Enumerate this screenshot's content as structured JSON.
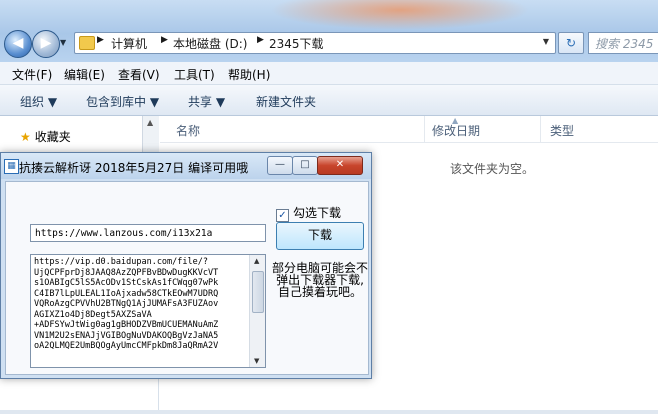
{
  "explorer": {
    "path": [
      "计算机",
      "本地磁盘 (D:)",
      "2345下载"
    ],
    "search_placeholder": "搜索 2345",
    "menu": [
      "文件(F)",
      "编辑(E)",
      "查看(V)",
      "工具(T)",
      "帮助(H)"
    ],
    "toolbar": [
      "组织 ▼",
      "包含到库中 ▼",
      "共享 ▼",
      "新建文件夹"
    ],
    "favorites": "收藏夹",
    "columns": [
      "名称",
      "修改日期",
      "类型"
    ],
    "empty_text": "该文件夹为空。"
  },
  "dialog": {
    "title": "抗揍云解析讶 2018年5月27日 编译可用哦",
    "checkbox_label": "勾选下载",
    "checkbox_checked": true,
    "url_value": "https://www.lanzous.com/i13x21a",
    "download_label": "下载",
    "result_text": "https://vip.d0.baidupan.com/file/?\nUjQCPFprDj8JAAQ8AzZQPFBvBDwDugKKVcVT\ns1OABIgC5lS5AcODv1StCskAs1fCWqg07wPk\nC4IB7lLpULEAL1IoAjxadw58CTkEOwM7UDRQ\nVQRoAzgCPVVhU2BTNgQ1AjJUMAFsA3FUZAov\nAGIXZ1o4Dj8Degt5AXZSaVA\n+ADFSYwJtWig0ag1gBHODZVBmUCUEMANuAmZ\nVN1M2U2sENAJjVGIBOgNuVDAKOQBgVzJaNA5\noA2QLMQE2UmBQOgAyUmcCMFpkDm8JaQRmA2V",
    "note": "部分电脑可能会不弹出下载器下载,自己摸着玩吧。"
  }
}
